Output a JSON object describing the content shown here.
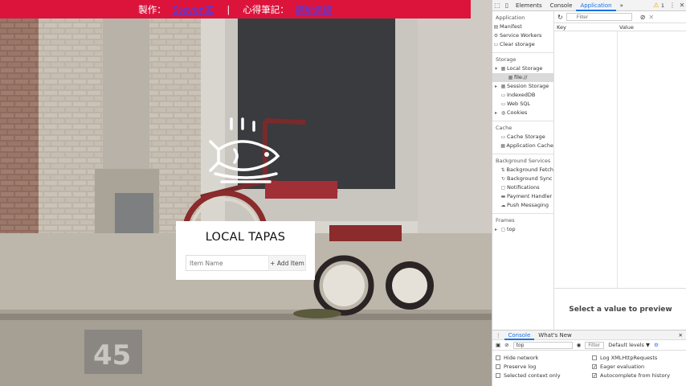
{
  "banner": {
    "made_by_label": "製作：",
    "author_link": "Steven玄",
    "separator": "|",
    "notes_label": "心得筆記：",
    "notes_link": "網址連結"
  },
  "app": {
    "title": "LOCAL TAPAS",
    "item_placeholder": "Item Name",
    "add_button": "+ Add Item"
  },
  "devtools": {
    "tabs": [
      "Elements",
      "Console",
      "Application",
      "»"
    ],
    "active_tab": "Application",
    "warning_count": "1",
    "sidebar": {
      "application_header": "Application",
      "application_items": [
        "Manifest",
        "Service Workers",
        "Clear storage"
      ],
      "storage_header": "Storage",
      "local_storage": "Local Storage",
      "local_storage_child": "file://",
      "storage_items": [
        "Session Storage",
        "IndexedDB",
        "Web SQL",
        "Cookies"
      ],
      "cache_header": "Cache",
      "cache_items": [
        "Cache Storage",
        "Application Cache"
      ],
      "background_header": "Background Services",
      "background_items": [
        "Background Fetch",
        "Background Sync",
        "Notifications",
        "Payment Handler",
        "Push Messaging"
      ],
      "frames_header": "Frames",
      "frames_items": [
        "top"
      ]
    },
    "filter_placeholder": "Filter",
    "columns": [
      "Key",
      "Value"
    ],
    "preview_text": "Select a value to preview",
    "drawer": {
      "tabs": [
        "Console",
        "What's New"
      ],
      "context": "top",
      "filter_placeholder": "Filter",
      "levels": "Default levels ▼",
      "options_left": [
        {
          "label": "Hide network",
          "checked": false
        },
        {
          "label": "Preserve log",
          "checked": false
        },
        {
          "label": "Selected context only",
          "checked": false
        }
      ],
      "options_right": [
        {
          "label": "Log XMLHttpRequests",
          "checked": false
        },
        {
          "label": "Eager evaluation",
          "checked": true
        },
        {
          "label": "Autocomplete from history",
          "checked": true
        }
      ]
    }
  },
  "colors": {
    "banner": "#dc143c",
    "link": "#3a40ff",
    "accent": "#1a73e8"
  }
}
